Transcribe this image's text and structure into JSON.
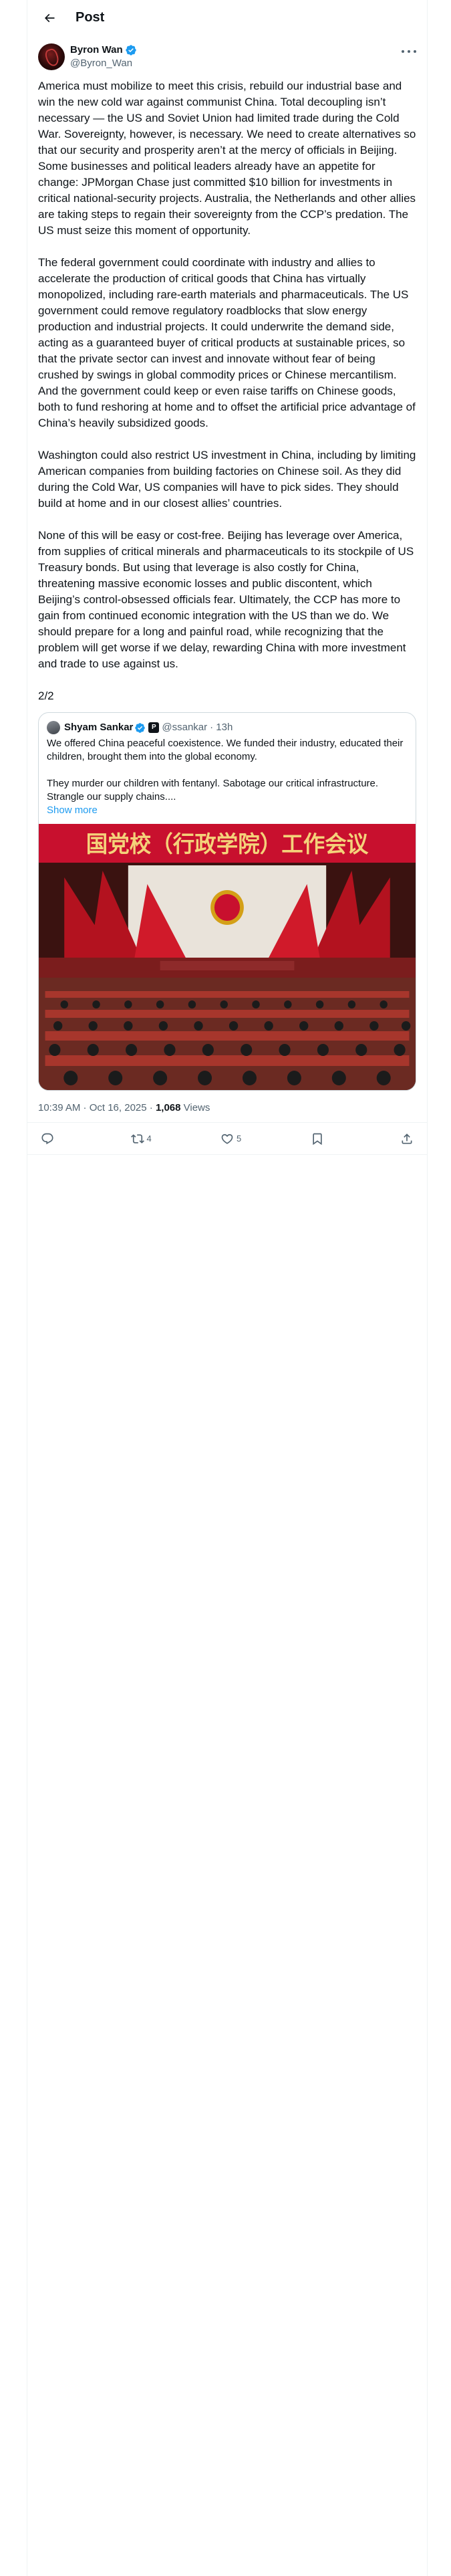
{
  "header": {
    "title": "Post"
  },
  "author": {
    "name": "Byron Wan",
    "handle": "@Byron_Wan"
  },
  "tweet": {
    "text": "America must mobilize to meet this crisis, rebuild our industrial base and win the new cold war against communist China. Total decoupling isn’t necessary — the US and Soviet Union had limited trade during the Cold War. Sovereignty, however, is necessary. We need to create alternatives so that our security and prosperity aren’t at the mercy of officials in Beijing. Some businesses and political leaders already have an appetite for change: JPMorgan Chase just committed $10 billion for investments in critical national-security projects. Australia, the Netherlands and other allies are taking steps to regain their sovereignty from the CCP’s predation. The US must seize this moment of opportunity.\n\nThe federal government could coordinate with industry and allies to accelerate the production of critical goods that China has virtually monopolized, including rare-earth materials and pharmaceuticals. The US government could remove regulatory roadblocks that slow energy production and industrial projects. It could underwrite the demand side, acting as a guaranteed buyer of critical products at sustainable prices, so that the private sector can invest and innovate without fear of being crushed by swings in global commodity prices or Chinese mercantilism. And the government could keep or even raise tariffs on Chinese goods, both to fund reshoring at home and to offset the artificial price advantage of China’s heavily subsidized goods.\n\nWashington could also restrict US investment in China, including by limiting American companies from building factories on Chinese soil. As they did during the Cold War, US companies will have to pick sides. They should build at home and in our closest allies’ countries.\n\nNone of this will be easy or cost-free. Beijing has leverage over America, from supplies of critical minerals and pharmaceuticals to its stockpile of US Treasury bonds. But using that leverage is also costly for China, threatening massive economic losses and public discontent, which Beijing’s control-obsessed officials fear. Ultimately, the CCP has more to gain from continued economic integration with the US than we do. We should prepare for a long and painful road, while recognizing that the problem will get worse if we delay, rewarding China with more investment and trade to use against us.\n\n2/2"
  },
  "quote": {
    "name": "Shyam Sankar",
    "affiliation_letter": "P",
    "handle": "@ssankar",
    "time": "· 13h",
    "text": "We offered China peaceful coexistence. We funded their industry, educated their children, brought them into the global economy.\n\nThey murder our children with fentanyl. Sabotage our critical infrastructure. Strangle our supply chains....",
    "show_more": "Show more",
    "image_banner": "国党校（行政学院）工作会议"
  },
  "meta": {
    "datetime": "10:39 AM · Oct 16, 2025 · ",
    "views_count": "1,068",
    "views_label": " Views"
  },
  "actions": {
    "reply_count": "",
    "repost_count": "4",
    "like_count": "5"
  },
  "colors": {
    "accent": "#1d9bf0",
    "verified": "#1d9bf0",
    "muted": "#536471",
    "banner_red": "#c8102e"
  }
}
